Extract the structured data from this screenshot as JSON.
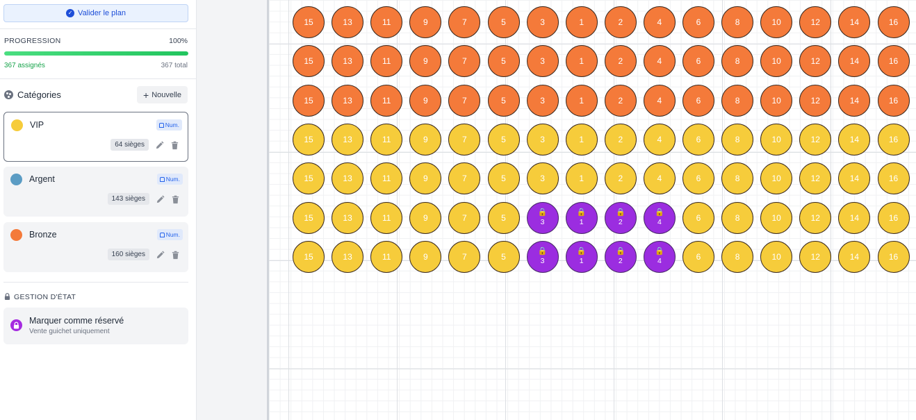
{
  "toolbar": {
    "validate_label": "Valider le plan"
  },
  "progress": {
    "title": "PROGRESSION",
    "percent_label": "100%",
    "value": 1.0,
    "assigned_label": "367 assignés",
    "total_label": "367 total"
  },
  "categories": {
    "title": "Catégories",
    "new_label": "Nouvelle",
    "num_badge": "Num.",
    "items": [
      {
        "name": "VIP",
        "color": "#f6cc3b",
        "count_label": "64 sièges",
        "selected": true
      },
      {
        "name": "Argent",
        "color": "#5b9cc4",
        "count_label": "143 sièges",
        "selected": false
      },
      {
        "name": "Bronze",
        "color": "#f47a3a",
        "count_label": "160 sièges",
        "selected": false
      }
    ]
  },
  "state_management": {
    "title": "GESTION D'ÉTAT",
    "reserve_title": "Marquer comme réservé",
    "reserve_subtitle": "Vente guichet uniquement",
    "reserve_color": "#a52be0"
  },
  "seat_map": {
    "column_numbers": [
      "15",
      "13",
      "11",
      "9",
      "7",
      "5",
      "3",
      "1",
      "2",
      "4",
      "6",
      "8",
      "10",
      "12",
      "14",
      "16"
    ],
    "rows": [
      {
        "category": "bronze",
        "reserved_columns": []
      },
      {
        "category": "bronze",
        "reserved_columns": []
      },
      {
        "category": "bronze",
        "reserved_columns": []
      },
      {
        "category": "vip",
        "reserved_columns": []
      },
      {
        "category": "vip",
        "reserved_columns": []
      },
      {
        "category": "vip",
        "reserved_columns": [
          "3",
          "1",
          "2",
          "4"
        ]
      },
      {
        "category": "vip",
        "reserved_columns": [
          "3",
          "1",
          "2",
          "4"
        ]
      }
    ],
    "colors": {
      "bronze": "#f47a3a",
      "vip": "#f6cc3b",
      "reserved": "#9b2de0"
    }
  }
}
